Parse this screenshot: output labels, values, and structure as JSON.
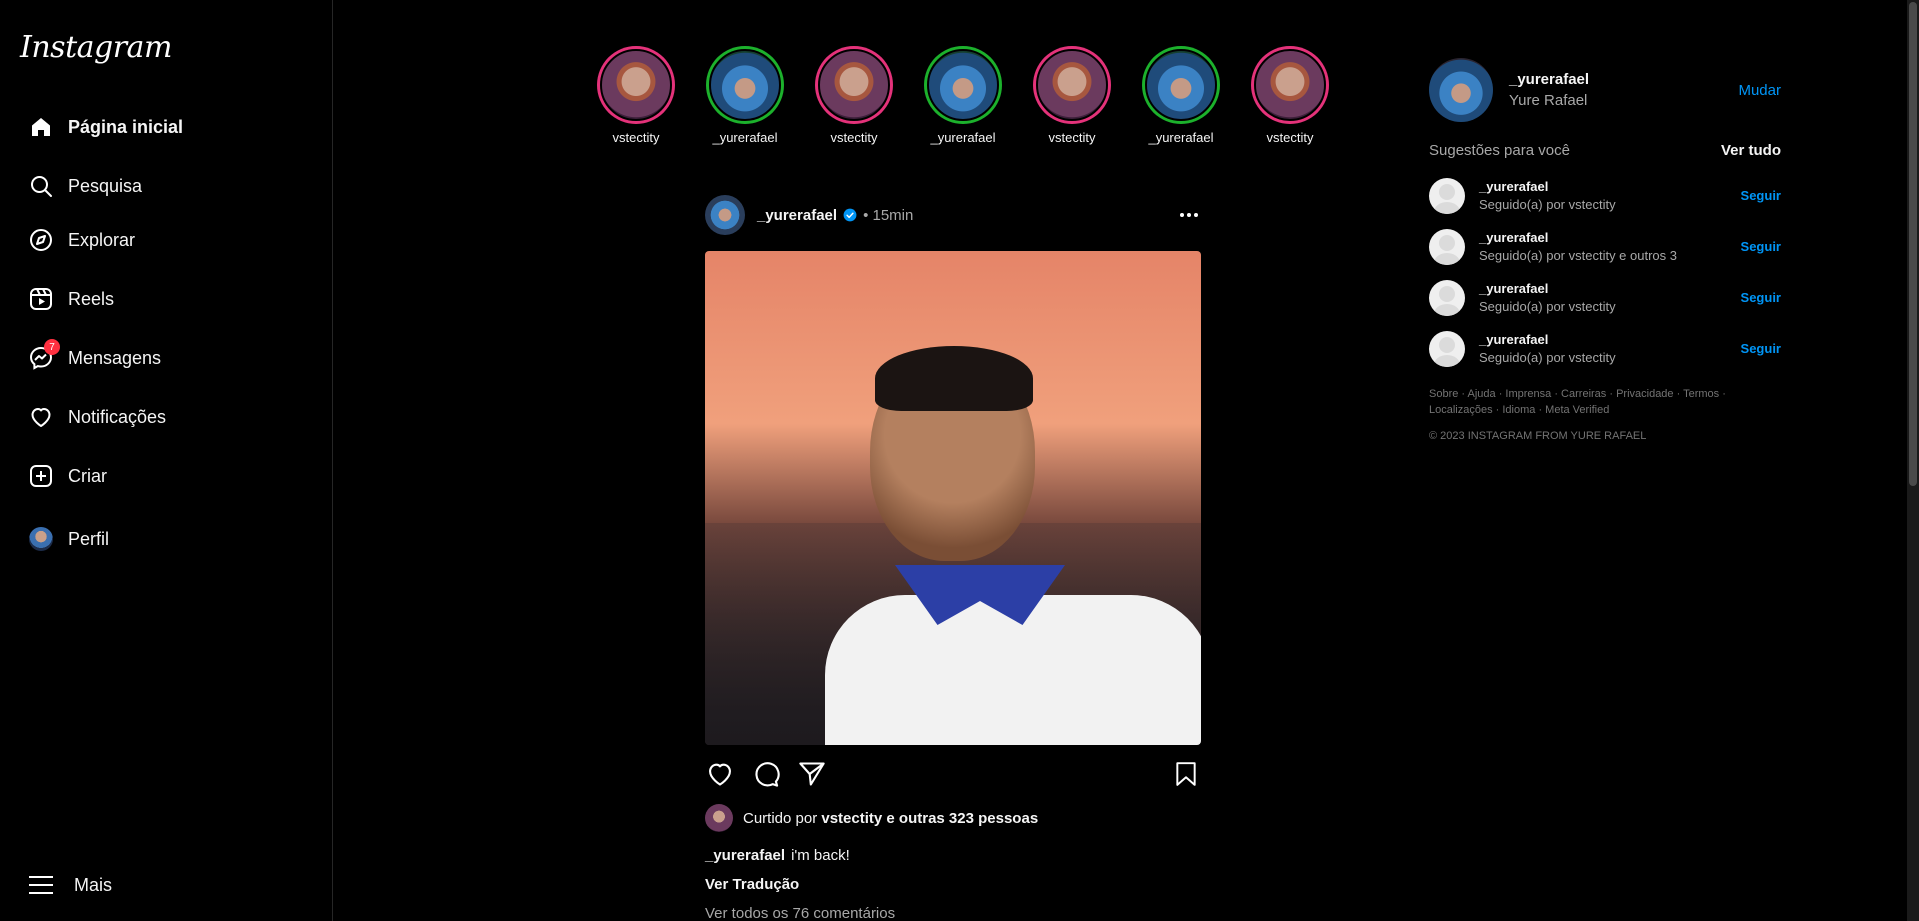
{
  "brand": {
    "logo": "Instagram"
  },
  "nav": {
    "home": "Página inicial",
    "search": "Pesquisa",
    "explore": "Explorar",
    "reels": "Reels",
    "messages": "Mensagens",
    "messages_badge": "7",
    "notifications": "Notificações",
    "create": "Criar",
    "profile": "Perfil",
    "more": "Mais"
  },
  "stories": [
    {
      "name": "vstectity",
      "ring": "pink"
    },
    {
      "name": "_yurerafael",
      "ring": "green"
    },
    {
      "name": "vstectity",
      "ring": "pink"
    },
    {
      "name": "_yurerafael",
      "ring": "green"
    },
    {
      "name": "vstectity",
      "ring": "pink"
    },
    {
      "name": "_yurerafael",
      "ring": "green"
    },
    {
      "name": "vstectity",
      "ring": "pink"
    }
  ],
  "post": {
    "username": "_yurerafael",
    "time": "• 15min",
    "liked_prefix": "Curtido por ",
    "liked_by": "vstectity e outras 323 pessoas",
    "caption_user": "_yurerafael",
    "caption_text": "i'm back!",
    "translate": "Ver Tradução",
    "comments": "Ver todos os 76 comentários"
  },
  "account": {
    "username": "_yurerafael",
    "name": "Yure Rafael",
    "switch": "Mudar"
  },
  "suggestions": {
    "title": "Sugestões para você",
    "see_all": "Ver tudo",
    "items": [
      {
        "username": "_yurerafael",
        "sub": "Seguido(a) por vstectity",
        "action": "Seguir"
      },
      {
        "username": "_yurerafael",
        "sub": "Seguido(a) por vstectity e outros 3",
        "action": "Seguir"
      },
      {
        "username": "_yurerafael",
        "sub": "Seguido(a) por vstectity",
        "action": "Seguir"
      },
      {
        "username": "_yurerafael",
        "sub": "Seguido(a) por vstectity",
        "action": "Seguir"
      }
    ]
  },
  "footer": {
    "links_line1": "Sobre · Ajuda · Imprensa · Carreiras · Privacidade · Termos ·",
    "links_line2": "Localizações · Idioma · Meta Verified",
    "copyright": "© 2023 INSTAGRAM FROM YURE RAFAEL"
  },
  "colors": {
    "accent": "#0095f6",
    "badge": "#ff3040",
    "story_pink": "#e4327a",
    "story_green": "#1cb12c"
  }
}
